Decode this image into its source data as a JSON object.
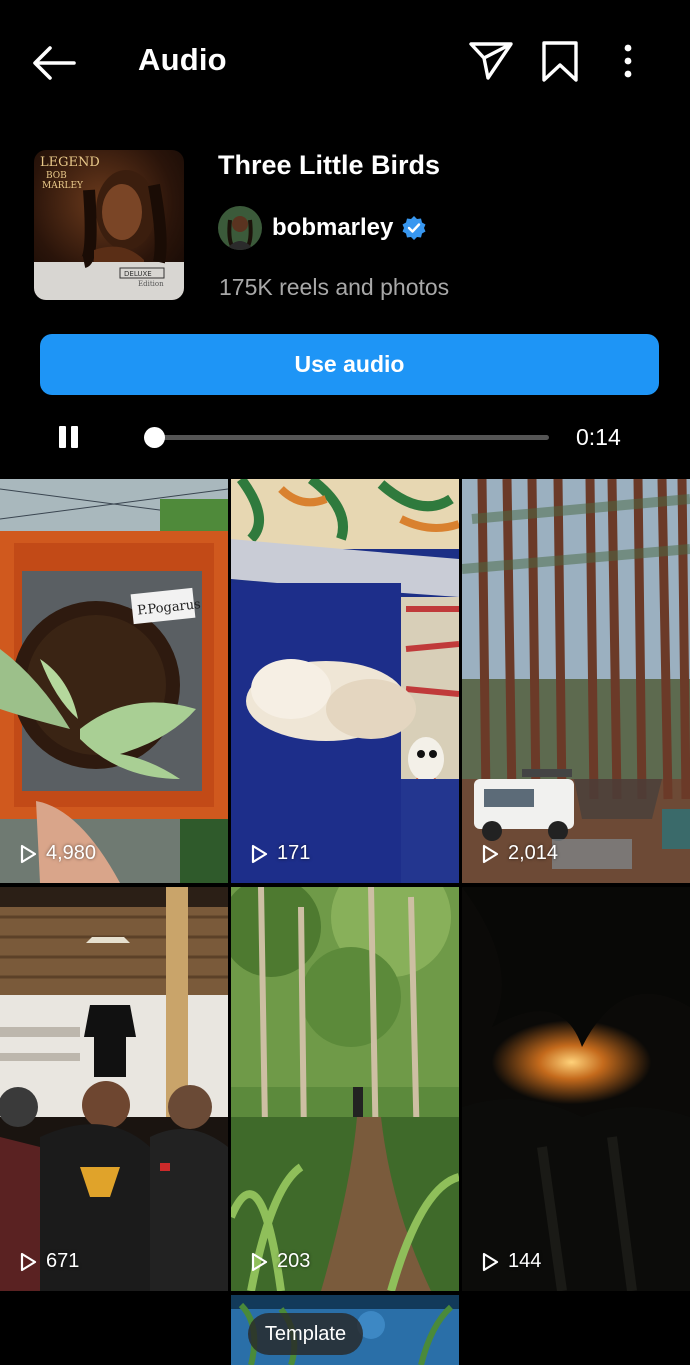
{
  "header": {
    "title": "Audio",
    "back_icon": "arrow-left-icon",
    "share_icon": "paper-plane-icon",
    "save_icon": "bookmark-icon",
    "more_icon": "more-vertical-icon"
  },
  "audio": {
    "title": "Three Little Birds",
    "artist": "bobmarley",
    "verified": true,
    "reels_count": "175K reels and photos",
    "cover_text": {
      "line1": "LEGEND",
      "line2": "BOB",
      "line3": "MARLEY",
      "badge": "DELUXE",
      "edition": "Edition"
    }
  },
  "use_audio_label": "Use audio",
  "player": {
    "state": "playing",
    "time": "0:14",
    "progress": 0.02
  },
  "reels": [
    {
      "views": "4,980",
      "sign_text": "P.Pogarus"
    },
    {
      "views": "171"
    },
    {
      "views": "2,014"
    },
    {
      "views": "671"
    },
    {
      "views": "203"
    },
    {
      "views": "144"
    },
    {
      "badge": "Template"
    }
  ],
  "colors": {
    "background": "#000000",
    "accent": "#1e95f6",
    "secondary_text": "#a8a8a8"
  }
}
